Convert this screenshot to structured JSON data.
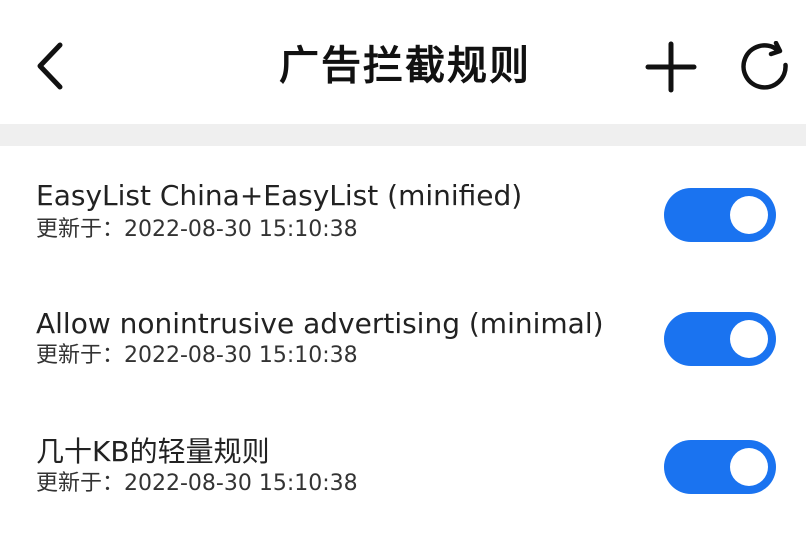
{
  "header": {
    "title": "广告拦截规则",
    "back_icon": "chevron-left-icon",
    "add_icon": "plus-icon",
    "refresh_icon": "refresh-icon"
  },
  "rules": [
    {
      "name": "EasyList China+EasyList (minified)",
      "updated": "更新于：2022-08-30 15:10:38",
      "enabled": true
    },
    {
      "name": "Allow nonintrusive advertising (minimal)",
      "updated": "更新于：2022-08-30 15:10:38",
      "enabled": true
    },
    {
      "name": "几十KB的轻量规则",
      "updated": "更新于：2022-08-30 15:10:38",
      "enabled": true
    }
  ],
  "colors": {
    "toggle_on": "#1a73f0",
    "toggle_off": "#c8c8c8",
    "divider": "#efefef"
  }
}
